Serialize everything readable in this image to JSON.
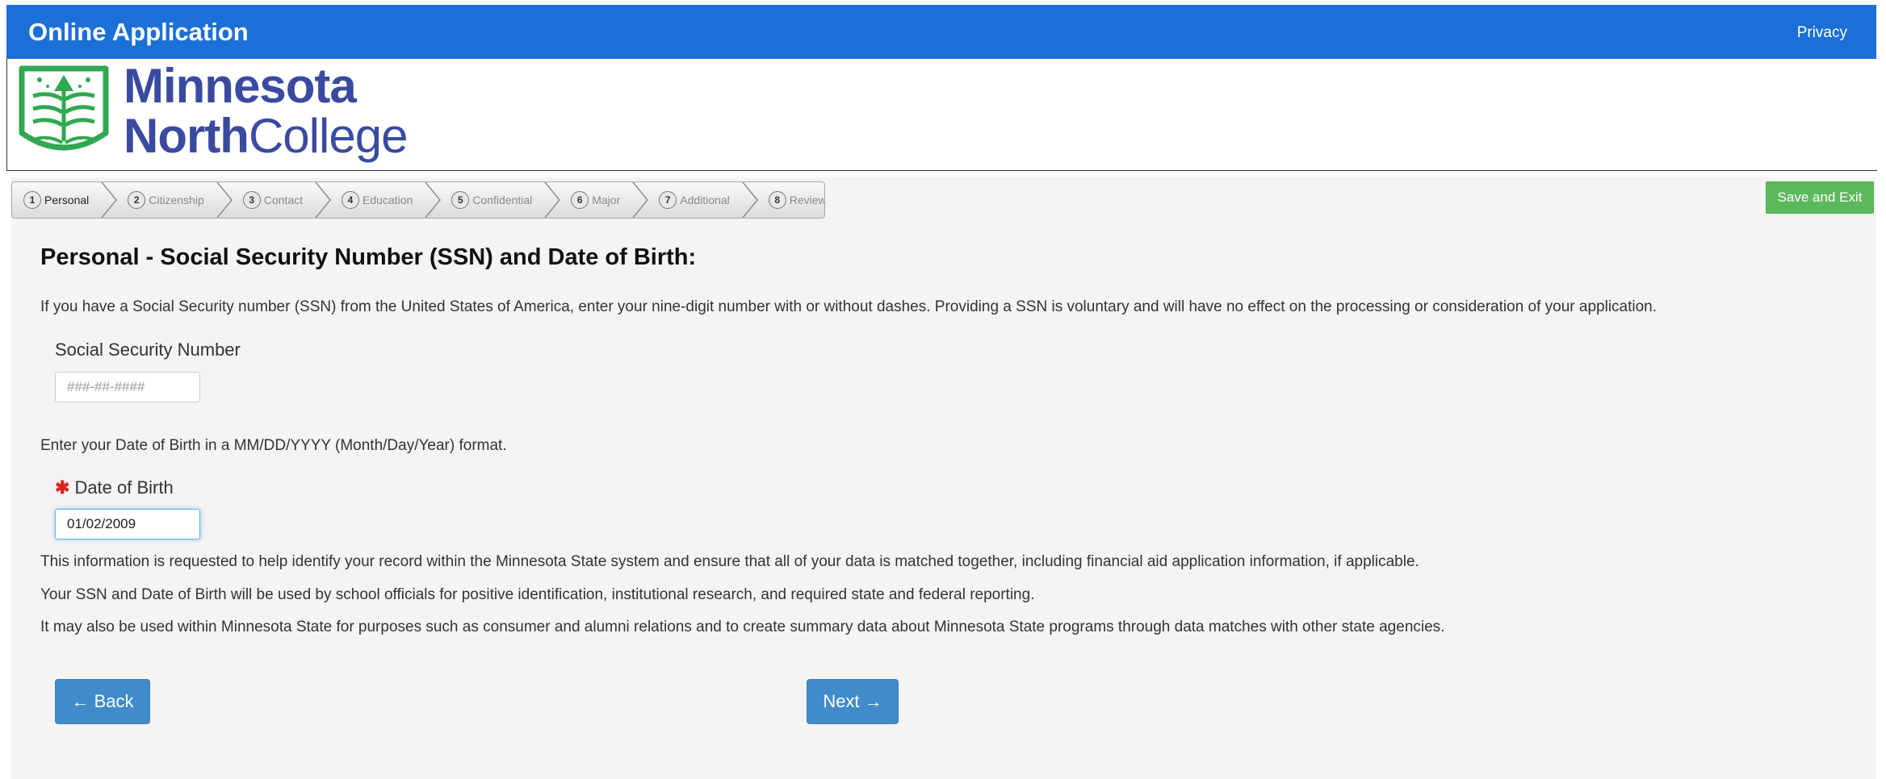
{
  "topbar": {
    "title": "Online Application",
    "privacy_label": "Privacy"
  },
  "logo": {
    "line1": "Minnesota",
    "line2_bold": "North",
    "line2_regular": "College"
  },
  "wizard": {
    "steps": [
      {
        "num": "1",
        "label": "Personal"
      },
      {
        "num": "2",
        "label": "Citizenship"
      },
      {
        "num": "3",
        "label": "Contact"
      },
      {
        "num": "4",
        "label": "Education"
      },
      {
        "num": "5",
        "label": "Confidential"
      },
      {
        "num": "6",
        "label": "Major"
      },
      {
        "num": "7",
        "label": "Additional"
      },
      {
        "num": "8",
        "label": "Review"
      }
    ],
    "active_index": 0
  },
  "save_exit_label": "Save and Exit",
  "page": {
    "heading": "Personal - Social Security Number (SSN) and Date of Birth:",
    "ssn_intro": "If you have a Social Security number (SSN) from the United States of America, enter your nine-digit number with or without dashes. Providing a SSN is voluntary and will have no effect on the processing or consideration of your application.",
    "ssn_label": "Social Security Number",
    "ssn_placeholder": "###-##-####",
    "ssn_value": "",
    "dob_intro": "Enter your Date of Birth in a MM/DD/YYYY (Month/Day/Year) format.",
    "required_mark": "✱",
    "dob_label": "Date of Birth",
    "dob_value": "01/02/2009",
    "info_1": "This information is requested to help identify your record within the Minnesota State system and ensure that all of your data is matched together, including financial aid application information, if applicable.",
    "info_2": "Your SSN and Date of Birth will be used by school officials for positive identification, institutional research, and required state and federal reporting.",
    "info_3": "It may also be used within Minnesota State for purposes such as consumer and alumni relations and to create summary data about Minnesota State programs through data matches with other state agencies."
  },
  "nav": {
    "back_label": "← Back",
    "next_label": "Next →"
  },
  "colors": {
    "topbar": "#1b6fd6",
    "logo_text": "#3a4aa0",
    "logo_emblem": "#2fa84f",
    "save_button": "#5cb85c",
    "nav_button": "#428bca",
    "required": "#d9261c"
  }
}
